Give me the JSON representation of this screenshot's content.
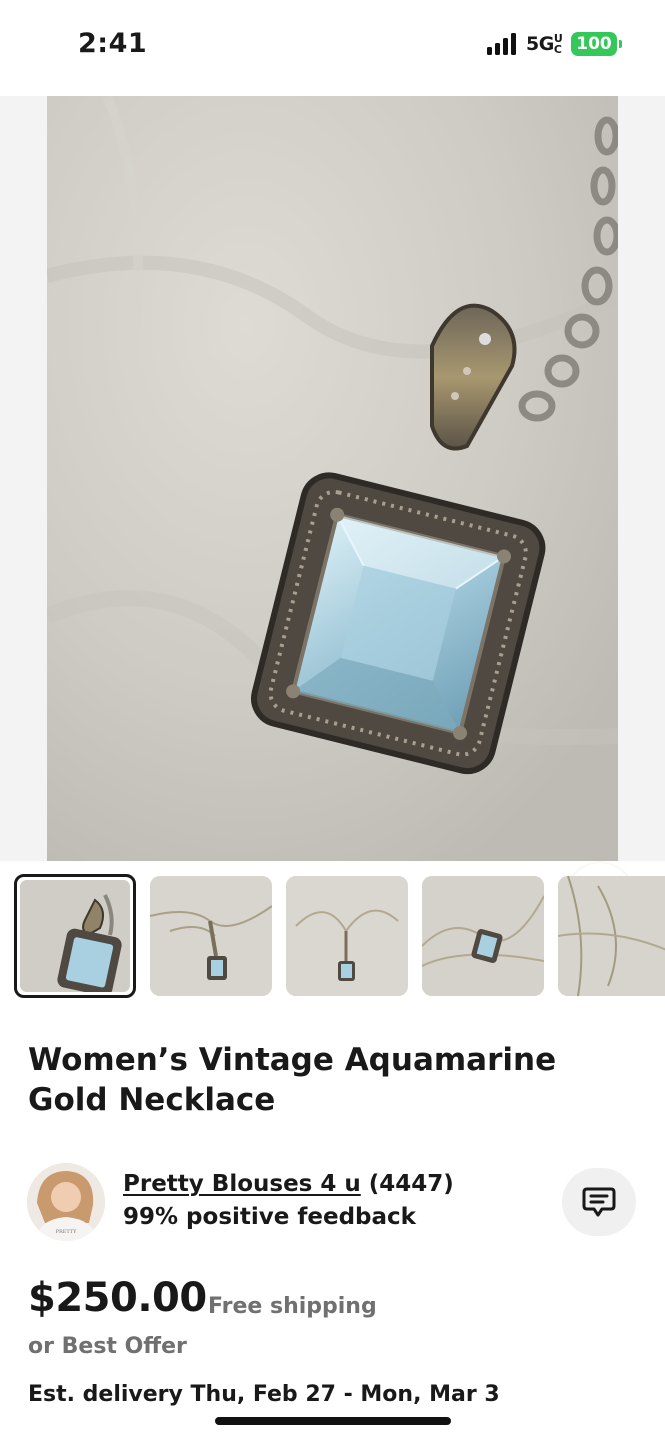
{
  "status_bar": {
    "time": "2:41",
    "network": "5G",
    "network_suffix": "UC",
    "battery": "100"
  },
  "listing": {
    "title": "Women’s Vintage Aquamarine Gold Necklace",
    "price": "$250.00",
    "shipping": "Free shipping",
    "best_offer": "or Best Offer",
    "delivery": "Est. delivery Thu, Feb 27 - Mon, Mar 3",
    "favorite_icon": "heart-icon"
  },
  "seller": {
    "name": "Pretty Blouses 4 u",
    "rating_count": "(4447)",
    "feedback": "99% positive feedback",
    "message_icon": "message-icon"
  },
  "thumbnails": [
    {
      "label": "photo-1",
      "selected": true
    },
    {
      "label": "photo-2",
      "selected": false
    },
    {
      "label": "photo-3",
      "selected": false
    },
    {
      "label": "photo-4",
      "selected": false
    },
    {
      "label": "photo-5",
      "selected": false
    }
  ],
  "colors": {
    "text_primary": "#191919",
    "text_secondary": "#707070",
    "battery_green": "#34c759"
  }
}
